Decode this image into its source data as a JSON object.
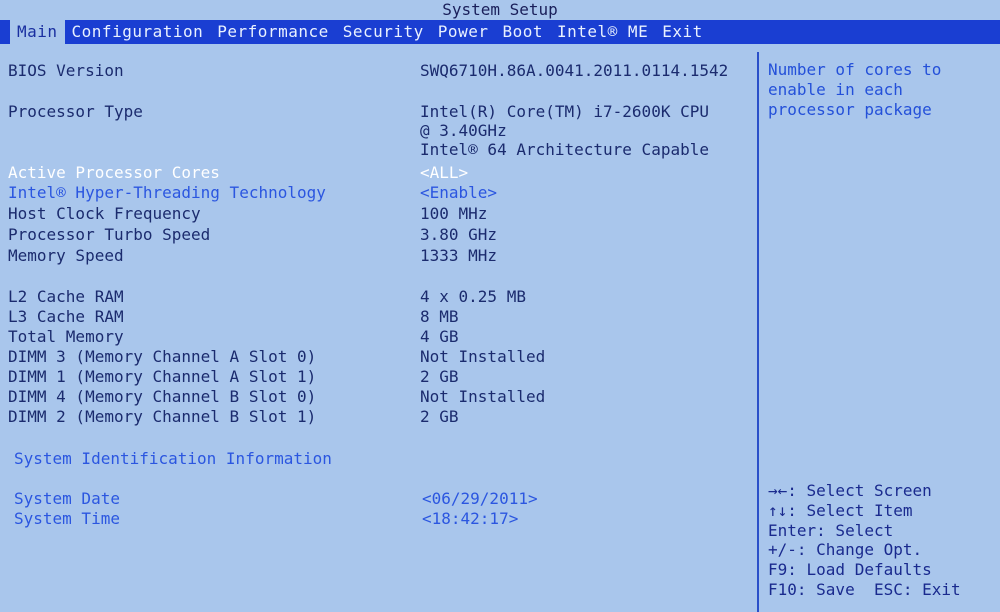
{
  "window_title": "System Setup",
  "tabs": [
    "Main",
    "Configuration",
    "Performance",
    "Security",
    "Power",
    "Boot",
    "Intel® ME",
    "Exit"
  ],
  "main": {
    "bios_version": {
      "label": "BIOS Version",
      "value": "SWQ6710H.86A.0041.2011.0114.1542"
    },
    "processor_type": {
      "label": "Processor Type",
      "value_lines": [
        "Intel(R) Core(TM) i7-2600K CPU",
        "@ 3.40GHz",
        "Intel® 64 Architecture Capable"
      ]
    },
    "active_cores": {
      "label": "Active Processor Cores",
      "value": "<ALL>"
    },
    "hyperthreading": {
      "label": "Intel® Hyper-Threading Technology",
      "value": "<Enable>"
    },
    "host_clock": {
      "label": "Host Clock Frequency",
      "value": "100 MHz"
    },
    "turbo_speed": {
      "label": "Processor Turbo Speed",
      "value": "3.80 GHz"
    },
    "memory_speed": {
      "label": "Memory Speed",
      "value": "1333 MHz"
    },
    "l2_cache": {
      "label": "L2 Cache RAM",
      "value": "4 x 0.25 MB"
    },
    "l3_cache": {
      "label": "L3 Cache RAM",
      "value": "8 MB"
    },
    "total_memory": {
      "label": "Total Memory",
      "value": "4 GB"
    },
    "dimm3": {
      "label": "DIMM 3 (Memory Channel A Slot 0)",
      "value": "Not Installed"
    },
    "dimm1": {
      "label": "DIMM 1 (Memory Channel A Slot 1)",
      "value": "2 GB"
    },
    "dimm4": {
      "label": "DIMM 4 (Memory Channel B Slot 0)",
      "value": "Not Installed"
    },
    "dimm2": {
      "label": "DIMM 2 (Memory Channel B Slot 1)",
      "value": "2 GB"
    },
    "system_id": {
      "label": "System Identification Information"
    },
    "system_date": {
      "label": "System Date",
      "value": "<06/29/2011>"
    },
    "system_time": {
      "label": "System Time",
      "value": "<18:42:17>"
    }
  },
  "help_lines": [
    "Number of cores to",
    "enable in each",
    "processor package"
  ],
  "key_help": [
    "→←: Select Screen",
    "↑↓: Select Item",
    "Enter: Select",
    "+/-: Change Opt.",
    "F9: Load Defaults",
    "F10: Save  ESC: Exit"
  ]
}
